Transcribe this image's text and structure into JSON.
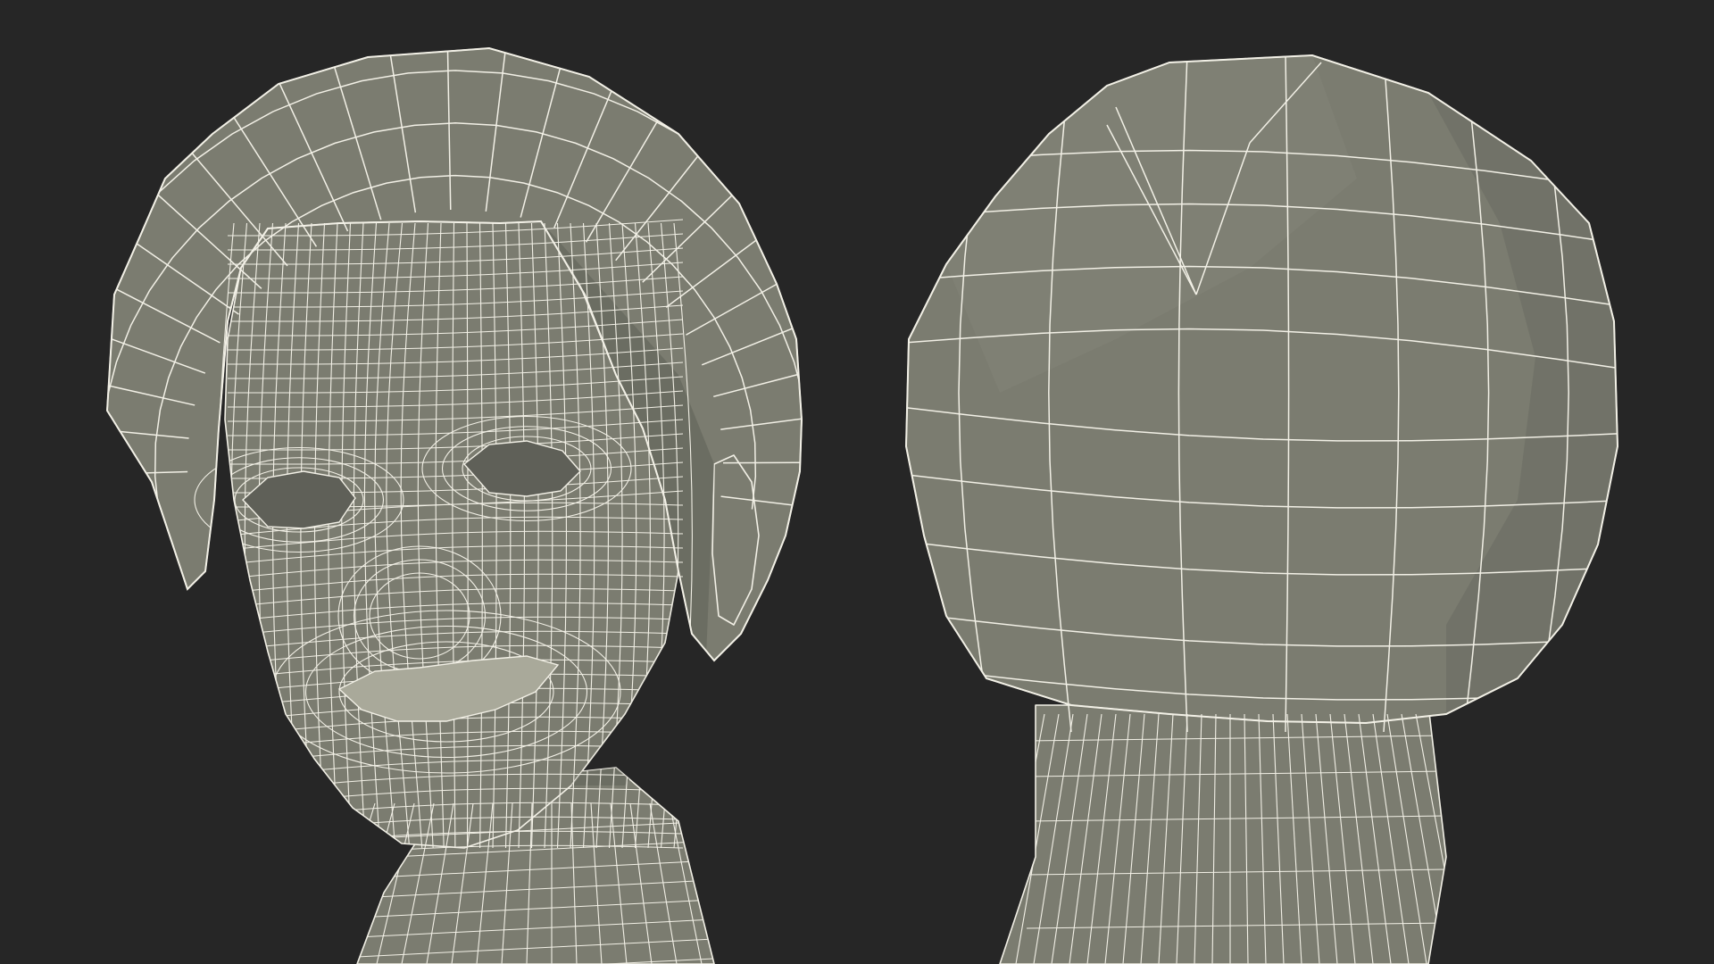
{
  "scene": {
    "background_color": "#262626",
    "mesh_fill_color": "#7b7c70",
    "mesh_shadow_color": "#5f6058",
    "mesh_highlight_color": "#8c8d80",
    "wire_color": "#f2f0e6",
    "views": [
      {
        "id": "front",
        "content": "head-front-wireframe"
      },
      {
        "id": "back",
        "content": "head-back-wireframe"
      }
    ]
  }
}
